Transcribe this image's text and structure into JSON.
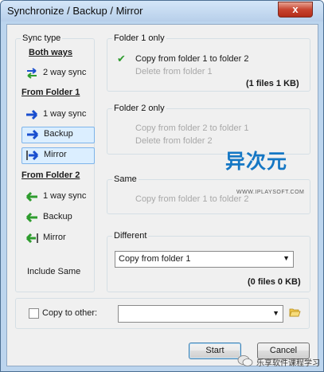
{
  "window": {
    "title": "Synchronize / Backup / Mirror",
    "close_label": "x"
  },
  "sidebar": {
    "sync_type_label": "Sync type",
    "both_ways_head": "Both ways",
    "both_ways_item": "2 way sync",
    "from_folder1_head": "From Folder 1",
    "from_folder1_items": [
      "1 way sync",
      "Backup",
      "Mirror"
    ],
    "from_folder2_head": "From Folder 2",
    "from_folder2_items": [
      "1 way sync",
      "Backup",
      "Mirror"
    ],
    "include_same": "Include Same"
  },
  "folder1_only": {
    "title": "Folder 1 only",
    "option_checked": "Copy from folder 1 to folder 2",
    "option_disabled": "Delete from folder 1",
    "stats": "(1 files 1 KB)"
  },
  "folder2_only": {
    "title": "Folder 2 only",
    "option1": "Copy from folder 2 to folder 1",
    "option2": "Delete from folder 2"
  },
  "same": {
    "title": "Same",
    "option": "Copy from folder 1 to folder 2"
  },
  "different": {
    "title": "Different",
    "selected": "Copy from folder 1",
    "stats": "(0 files 0 KB)"
  },
  "copy_other": {
    "label": "Copy to other:",
    "checked": false,
    "value": ""
  },
  "buttons": {
    "start": "Start",
    "cancel": "Cancel"
  },
  "watermark": {
    "text": "异次元",
    "sub": "WWW.IPLAYSOFT.COM"
  },
  "brand": {
    "text": "乐享软件课程学习"
  },
  "colors": {
    "accent_blue": "#1a4fcf",
    "accent_green": "#2e9c2e",
    "selection": "#dbeeff"
  },
  "icons": {
    "sync_both": "two-way-arrows-icon",
    "right_arrow": "right-arrow-icon",
    "left_arrow": "left-arrow-icon",
    "check": "check-icon",
    "folder": "open-folder-icon"
  }
}
